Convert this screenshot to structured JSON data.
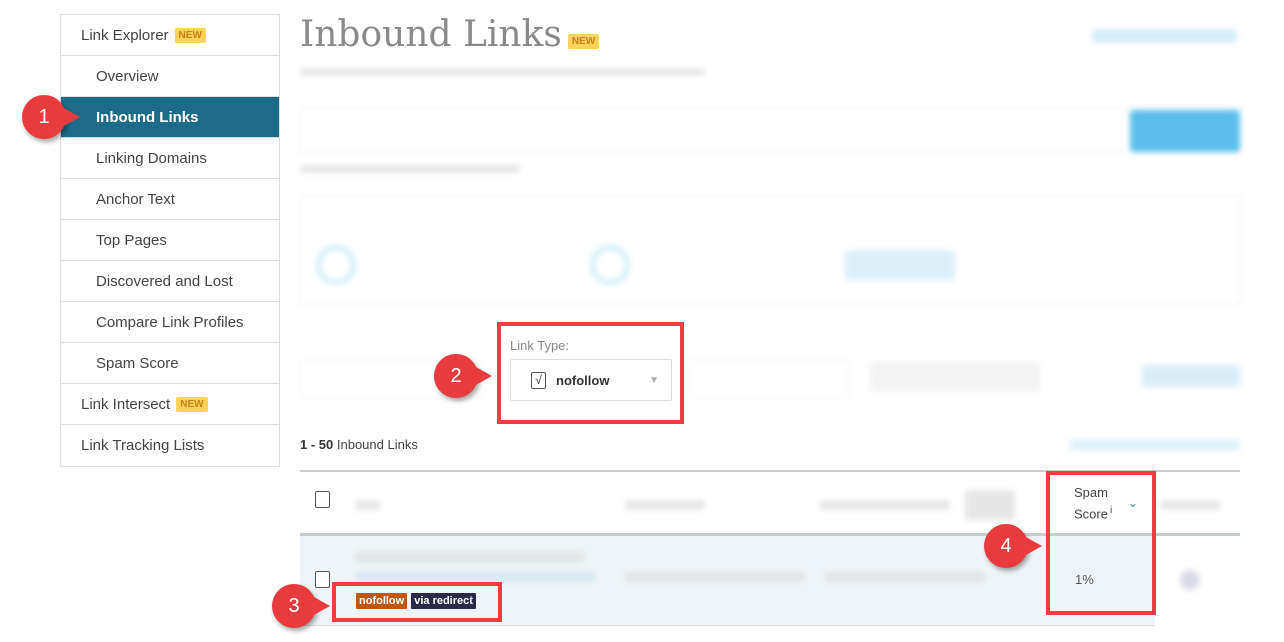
{
  "sidebar": {
    "items": [
      {
        "label": "Link Explorer",
        "badge": "NEW"
      },
      {
        "label": "Overview"
      },
      {
        "label": "Inbound Links"
      },
      {
        "label": "Linking Domains"
      },
      {
        "label": "Anchor Text"
      },
      {
        "label": "Top Pages"
      },
      {
        "label": "Discovered and Lost"
      },
      {
        "label": "Compare Link Profiles"
      },
      {
        "label": "Spam Score"
      },
      {
        "label": "Link Intersect",
        "badge": "NEW"
      },
      {
        "label": "Link Tracking Lists"
      }
    ]
  },
  "header": {
    "title": "Inbound Links",
    "badge": "NEW"
  },
  "filters": {
    "link_type_label": "Link Type:",
    "link_type_value": "nofollow",
    "checkbox_glyph": "√"
  },
  "results": {
    "range": "1 - 50",
    "label": "Inbound Links"
  },
  "table": {
    "spam_header_1": "Spam",
    "spam_header_2": "Score",
    "info": "i",
    "rows": [
      {
        "spam_score": "1%",
        "badges": [
          "nofollow",
          "via redirect"
        ]
      }
    ]
  },
  "annotations": [
    "1",
    "2",
    "3",
    "4"
  ],
  "colors": {
    "active": "#1d6a89",
    "marker": "#e83b3d",
    "nofollow_badge": "#c0570f",
    "redirect_badge": "#2c2a4a",
    "accent": "#4ab8e8"
  }
}
